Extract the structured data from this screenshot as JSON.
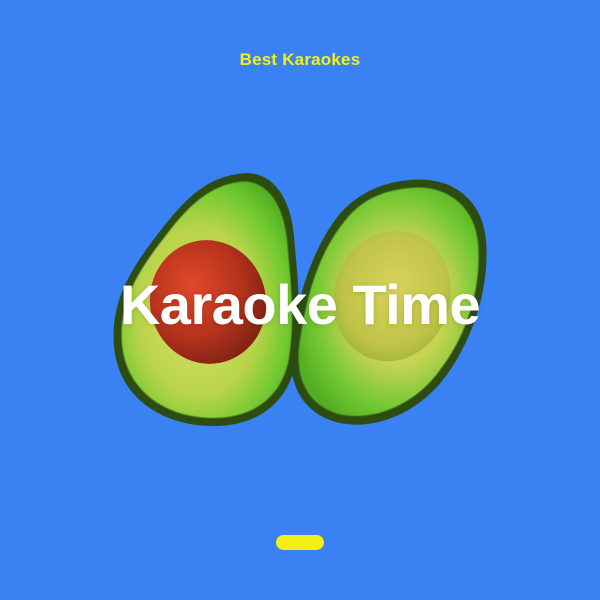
{
  "cover": {
    "subtitle": "Best Karaokes",
    "title": "Karaoke Time",
    "image_name": "avocado-halves-illustration"
  },
  "colors": {
    "background": "#3a82f4",
    "accent": "#f5f014",
    "title": "#ffffff",
    "avocado_skin": "#2c4a10",
    "avocado_flesh_outer": "#5fc22a",
    "avocado_flesh_inner": "#d8d65a",
    "pit": "#b9361e"
  },
  "controls": {
    "indicator_pill": "pill-indicator"
  }
}
